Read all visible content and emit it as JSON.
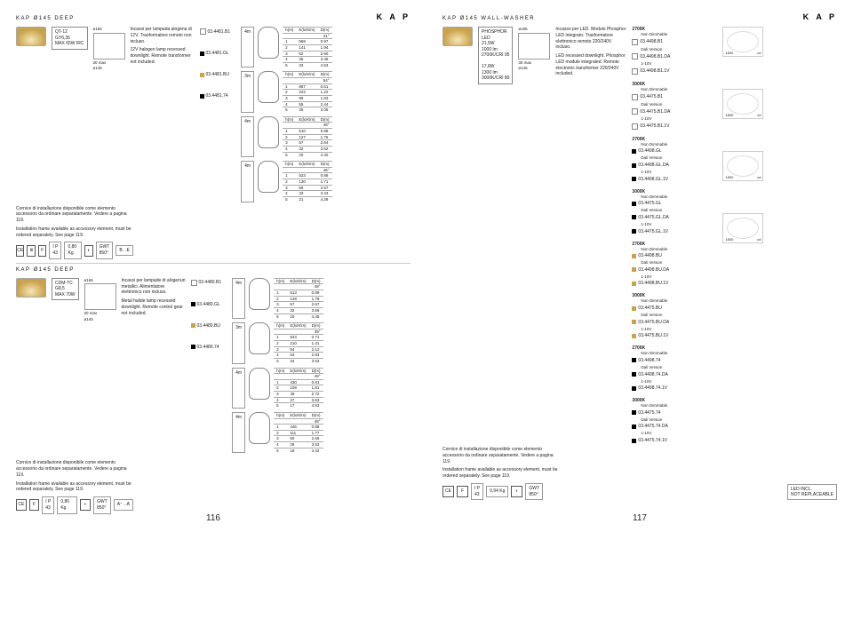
{
  "brand": "K A P",
  "left": {
    "title1": "KAP Ø145 DEEP",
    "lamp1_box": "QT-12\nGY6,35\nMAX 65W IRC",
    "dim1": "ø155",
    "dim2": "30 max",
    "dim3": "ø145",
    "desc1_it": "Incassi per lampada alogena di 12V. Trasformatore remoto non incluso.",
    "desc1_en": "12V halogen lamp recessed downlight. Remote transformer not included.",
    "codes1": [
      {
        "c": "wh",
        "v": "03.4481.B1"
      },
      {
        "c": "bk",
        "v": "03.4481.GL"
      },
      {
        "c": "gd",
        "v": "03.4481.BU"
      },
      {
        "c": "bk",
        "v": "03.4481.74"
      }
    ],
    "tables1": [
      {
        "lbl": "4m",
        "ang": "41°",
        "rows": [
          [
            "1",
            "568",
            "0.97"
          ],
          [
            "2",
            "141",
            "1.94"
          ],
          [
            "3",
            "62",
            "2.90"
          ],
          [
            "4",
            "35",
            "3.46"
          ],
          [
            "5",
            "33",
            "4.53"
          ]
        ]
      },
      {
        "lbl": "3m",
        "ang": "54°",
        "rows": [
          [
            "1",
            "887",
            "0.61"
          ],
          [
            "2",
            "222",
            "1.22"
          ],
          [
            "3",
            "99",
            "1.83"
          ],
          [
            "4",
            "55",
            "2.44"
          ],
          [
            "5",
            "35",
            "3.05"
          ]
        ]
      },
      {
        "lbl": "4m",
        "ang": "48°",
        "rows": [
          [
            "1",
            "510",
            "0.88"
          ],
          [
            "2",
            "127",
            "1.76"
          ],
          [
            "3",
            "57",
            "2.64"
          ],
          [
            "4",
            "32",
            "3.52"
          ],
          [
            "5",
            "20",
            "4.40"
          ]
        ]
      },
      {
        "lbl": "4m",
        "ang": "46°",
        "rows": [
          [
            "1",
            "523",
            "0.86"
          ],
          [
            "2",
            "130",
            "1.71"
          ],
          [
            "3",
            "58",
            "2.57"
          ],
          [
            "4",
            "33",
            "3.43"
          ],
          [
            "5",
            "21",
            "4.28"
          ]
        ]
      }
    ],
    "note_it": "Cornice di installazione disponibile come elemento accessorio da ordinare separatamente. Vedere a pagina 119.",
    "note_en": "Installation frame available as accessory element, must be ordered separately. See page 119.",
    "spec_row": {
      "ip": "I P\n43",
      "kg": "0,80 Kg",
      "gwt": "GWT\n850°",
      "cls": "B→E"
    },
    "title2": "KAP Ø145 DEEP",
    "lamp2_box": "CDM-TC\nG8,5\nMAX 70W",
    "dim2a": "ø165",
    "dim2b": "30 max",
    "dim2c": "ø145",
    "desc2_it": "Incassi per lampade di alogenuri metallici. Alimentatore elettronico non incluso.",
    "desc2_en": "Metal halide lamp recessed downlight. Remote control gear not included.",
    "codes2": [
      {
        "c": "wh",
        "v": "03.4480.B1"
      },
      {
        "c": "bk",
        "v": "03.4480.GL"
      },
      {
        "c": "gd",
        "v": "03.4480.BU"
      },
      {
        "c": "bk",
        "v": "03.4480.74"
      }
    ],
    "tables2": [
      {
        "lbl": "4m",
        "ang": "48°",
        "rows": [
          [
            "1",
            "513",
            "0.89"
          ],
          [
            "2",
            "128",
            "1.78"
          ],
          [
            "3",
            "57",
            "2.67"
          ],
          [
            "4",
            "32",
            "3.56"
          ],
          [
            "5",
            "20",
            "4.45"
          ]
        ]
      },
      {
        "lbl": "3m",
        "ang": "39°",
        "rows": [
          [
            "1",
            "843",
            "0.71"
          ],
          [
            "2",
            "210",
            "1.41"
          ],
          [
            "3",
            "94",
            "2.12"
          ],
          [
            "4",
            "53",
            "2.83"
          ],
          [
            "5",
            "34",
            "3.53"
          ]
        ]
      },
      {
        "lbl": "4m",
        "ang": "49°",
        "rows": [
          [
            "1",
            "430",
            "0.91"
          ],
          [
            "2",
            "108",
            "1.81"
          ],
          [
            "3",
            "48",
            "2.72"
          ],
          [
            "4",
            "27",
            "3.63"
          ],
          [
            "5",
            "17",
            "4.53"
          ]
        ]
      },
      {
        "lbl": "4m",
        "ang": "48°",
        "rows": [
          [
            "1",
            "446",
            "0.88"
          ],
          [
            "2",
            "111",
            "1.77"
          ],
          [
            "3",
            "50",
            "2.65"
          ],
          [
            "4",
            "28",
            "3.53"
          ],
          [
            "5",
            "18",
            "4.42"
          ]
        ]
      }
    ],
    "spec_row2": {
      "ip": "I P\n43",
      "kg": "0,80 Kg",
      "gwt": "GWT\n850°",
      "cls": "A⁺→A"
    },
    "pgno": "116"
  },
  "right": {
    "title1": "KAP Ø145 WALL-WASHER",
    "led_box": "PHOSPHOR\nLED\n21,5W\n1000 lm\n2700K/CRI 95\n\n17,8W\n1300 lm\n3000K/CRI 80",
    "dim1": "ø165",
    "dim2": "30 max",
    "dim3": "ø145",
    "desc_it": "Incasso per LED. Modulo Phosphor LED integrato. Trasformatore elettronico remoto 220/240V incluso.",
    "desc_en": "LED recessed downlight. Phosphor LED module integrated. Remote electronic transformer 220/240V included.",
    "groups": [
      {
        "hdr": "2700K",
        "items": [
          {
            "t": "Non Dimmable",
            "c": "wh",
            "v": "03.4498.B1"
          },
          {
            "t": "Dali Version",
            "c": "wh",
            "v": "03.4498.B1.DA"
          },
          {
            "t": "1-10V",
            "c": "wh",
            "v": "03.4498.B1.1V"
          }
        ],
        "polar": true
      },
      {
        "hdr": "3000K",
        "items": [
          {
            "t": "Non Dimmable",
            "c": "wh",
            "v": "03.4475.B1"
          },
          {
            "t": "Dali Version",
            "c": "wh",
            "v": "03.4475.B1.DA"
          },
          {
            "t": "1-10V",
            "c": "wh",
            "v": "03.4475.B1.1V"
          }
        ]
      },
      {
        "hdr": "2700K",
        "items": [
          {
            "t": "Non Dimmable",
            "c": "bk",
            "v": "03.4498.GL"
          },
          {
            "t": "Dali Version",
            "c": "bk",
            "v": "03.4498.GL.DA"
          },
          {
            "t": "1-10V",
            "c": "bk",
            "v": "03.4498.GL.1V"
          }
        ],
        "polar": true
      },
      {
        "hdr": "3000K",
        "items": [
          {
            "t": "Non Dimmable",
            "c": "bk",
            "v": "03.4475.GL"
          },
          {
            "t": "Dali Version",
            "c": "bk",
            "v": "03.4475.GL.DA"
          },
          {
            "t": "1-10V",
            "c": "bk",
            "v": "03.4475.GL.1V"
          }
        ]
      },
      {
        "hdr": "2700K",
        "items": [
          {
            "t": "Non Dimmable",
            "c": "gd",
            "v": "03.4498.BU"
          },
          {
            "t": "Dali Version",
            "c": "gd",
            "v": "03.4498.BU.DA"
          },
          {
            "t": "1-10V",
            "c": "gd",
            "v": "03.4498.BU.1V"
          }
        ],
        "polar": true
      },
      {
        "hdr": "3000K",
        "items": [
          {
            "t": "Non Dimmable",
            "c": "gd",
            "v": "03.4475.BU"
          },
          {
            "t": "Dali Version",
            "c": "gd",
            "v": "03.4475.BU.DA"
          },
          {
            "t": "1-10V",
            "c": "gd",
            "v": "03.4475.BU.1V"
          }
        ]
      },
      {
        "hdr": "2700K",
        "items": [
          {
            "t": "Non Dimmable",
            "c": "bk",
            "v": "03.4498.74"
          },
          {
            "t": "Dali Version",
            "c": "bk",
            "v": "03.4498.74.DA"
          },
          {
            "t": "1-10V",
            "c": "bk",
            "v": "03.4498.74.1V"
          }
        ],
        "polar": true
      },
      {
        "hdr": "3000K",
        "items": [
          {
            "t": "Non Dimmable",
            "c": "bk",
            "v": "03.4475.74"
          },
          {
            "t": "Dali Version",
            "c": "bk",
            "v": "03.4475.74.DA"
          },
          {
            "t": "1-10V",
            "c": "bk",
            "v": "03.4475.74.1V"
          }
        ]
      }
    ],
    "note_it": "Cornice di installazione disponibile come elemento accessorio da ordinare separatamente. Vedere a pagina 119.",
    "note_en": "Installation frame available as accessory element, must be ordered separately. See page 119.",
    "spec_row": {
      "ip": "I P\n43",
      "kg": "0,94 Kg",
      "gwt": "GWT\n850°"
    },
    "led_note": "LED INCL.\nNOT REPLACEABLE",
    "polar_lbl1": "1800",
    "polar_lbl2": "cd",
    "polar_lbl3": "2700",
    "polar_lbl4": "3000",
    "pgno": "117"
  },
  "tblhdr": {
    "a": "h(m)",
    "b": "E(lx/Klm)",
    "c": "D(m)"
  }
}
